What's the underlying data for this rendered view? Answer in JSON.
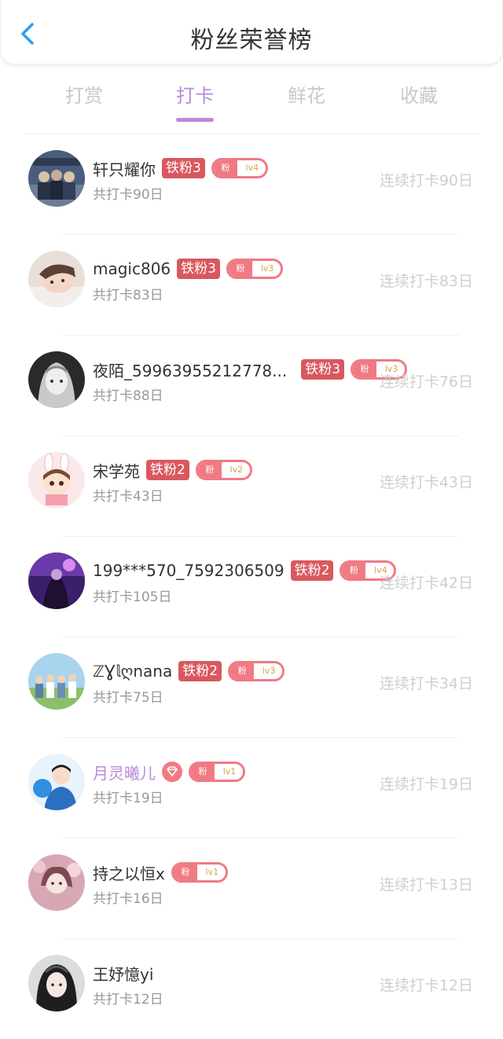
{
  "header": {
    "title": "粉丝荣誉榜"
  },
  "tabs": [
    {
      "label": "打赏"
    },
    {
      "label": "打卡"
    },
    {
      "label": "鲜花"
    },
    {
      "label": "收藏"
    }
  ],
  "active_tab": 1,
  "colors": {
    "accent": "#b98ad9",
    "back_icon": "#2b9ef4",
    "badge_red": "#d9585f",
    "fan_pink": "#f07a84",
    "level_gold": "#d8a24a"
  },
  "users": [
    {
      "name": "轩只耀你",
      "tie": "铁粉3",
      "fan": "粉",
      "lv": "lv4",
      "total": "共打卡90日",
      "streak": "连续打卡90日"
    },
    {
      "name": "magic806",
      "tie": "铁粉3",
      "fan": "粉",
      "lv": "lv3",
      "total": "共打卡83日",
      "streak": "连续打卡83日"
    },
    {
      "name": "夜陌_59963955212778...",
      "tie": "铁粉3",
      "fan": "粉",
      "lv": "lv3",
      "total": "共打卡88日",
      "streak": "连续打卡76日"
    },
    {
      "name": "宋学苑",
      "tie": "铁粉2",
      "fan": "粉",
      "lv": "lv2",
      "total": "共打卡43日",
      "streak": "连续打卡43日"
    },
    {
      "name": "199***570_7592306509",
      "tie": "铁粉2",
      "fan": "粉",
      "lv": "lv4",
      "total": "共打卡105日",
      "streak": "连续打卡42日"
    },
    {
      "name": "ℤƔ𝕝ღnana",
      "tie": "铁粉2",
      "fan": "粉",
      "lv": "lv3",
      "total": "共打卡75日",
      "streak": "连续打卡34日"
    },
    {
      "name": "月灵曦儿",
      "fan": "粉",
      "lv": "lv1",
      "total": "共打卡19日",
      "streak": "连续打卡19日"
    },
    {
      "name": "持之以恒x",
      "fan": "粉",
      "lv": "lv1",
      "total": "共打卡16日",
      "streak": "连续打卡13日"
    },
    {
      "name": "王妤憶yi",
      "total": "共打卡12日",
      "streak": "连续打卡12日"
    }
  ]
}
